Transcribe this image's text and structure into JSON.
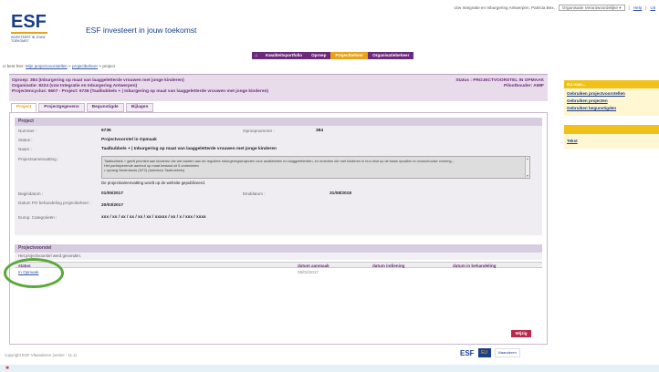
{
  "header": {
    "logo_big": "ESF",
    "logo_sub": "INVESTEERT IN JOUW TOEKOMST",
    "tagline": "ESF investeert in jouw toekomst",
    "user_text": "vzw Integratie en Inburgering Antwerpen, Patricia Bex,",
    "org_select": "Organisatie Verantwoordelijke",
    "help_link": "Help",
    "logout_link": "Uit"
  },
  "nav": {
    "home_icon": "home-icon",
    "items": [
      {
        "label": "Kwaliteitsportfolio"
      },
      {
        "label": "Oproep"
      },
      {
        "label": "Projectbeheer"
      },
      {
        "label": "Organisatiebeheer"
      }
    ]
  },
  "breadcrumb": {
    "prefix": "U bent hier:",
    "link1": "Mijn projectvoorstellen",
    "sep1": ">",
    "link2": "projectbeheer",
    "sep2": ">",
    "current": "project"
  },
  "project_header": {
    "line1": "Oproep: 384 (Inburgering op maat van laaggeletterde vrouwen met jonge kinderen)",
    "line2": "Organisatie: 8224 (vzw Integratie en Inburgering Antwerpen)",
    "line3": "Projectencyclus: 5607 - Project: 6736 (Taalbubbels + | Inburgering op maat van laaggeletterde vrouwen met jonge kinderen)",
    "status": "Status : PROJECTVOORSTEL IN OPMAAK",
    "promoter": "Pilootbouder: AMIF"
  },
  "tabs": [
    {
      "label": "Project"
    },
    {
      "label": "Projectgegevens"
    },
    {
      "label": "Begunstigde"
    },
    {
      "label": "Bijlagen"
    }
  ],
  "project_section": {
    "title": "Project",
    "nummer_label": "Nummer :",
    "nummer_value": "6736",
    "oproep_label": "Oproepnummer :",
    "oproep_value": "384",
    "status_label": "Status :",
    "status_value": "Projectvoorstel in Opmaak",
    "naam_label": "Naam :",
    "naam_value": "Taalbubbels + | Inburgering op maat van laaggeletterde vrouwen met jonge kinderen",
    "samenvatting_label": "Projectsamenvatting :",
    "samenvatting_text": "Taalbubbels + geeft prioriteit aan kinderen die wel starten aan de reguliere inburgeringstrajecten voor analfabeten en laaggeletterden, en moeders die met kinderen in hun kind op de basis opvallen in voorschoolse vorming...",
    "samenvatting_text2": "Het participerende aanbod op maat bestaat uit 5 onderdelen",
    "samenvatting_text3": "• opvang Nederlands (NT2) (talenhuis Taalbubbels)",
    "samenvatting_note": "De projectsamenvatting wordt op de website gepubliceerd.",
    "begindatum_label": "Begindatum :",
    "begindatum_value": "01/05/2017",
    "einddatum_label": "Einddatum :",
    "einddatum_value": "31/08/2018",
    "datum_label": "Datum PO behandeling projectbeheer :",
    "datum_value": "20/03/2017",
    "europ_label": "Europ. Categorieën :",
    "europ_value": "xxx / xx / xx / xx / xx / xx / xxxxx / xx / x / xxx / xxxx"
  },
  "projectvoorstel": {
    "title": "Projectvoorstel",
    "note": "Het projectvoorstel werd gevonden.",
    "col_status": "status",
    "col_aanmaak": "datum aanmaak",
    "col_indiening": "datum indiening",
    "col_behandeling": "datum in behandeling",
    "row_status": "In Opmaak",
    "row_aanmaak": "08/02/2017",
    "row_indiening": "",
    "row_behandeling": ""
  },
  "action": {
    "wijzig": "Wijzig"
  },
  "sidebar": {
    "title": "Ga naar...",
    "links": [
      {
        "label": "Gebruiken projectvoorstellen"
      },
      {
        "label": "Gebruiken projecten"
      },
      {
        "label": "Gebruiken begunstigden"
      }
    ],
    "title2": "",
    "link2": "Tekst"
  },
  "footer": {
    "copyright": "copyright ESF Vlaanderen",
    "version": "(versie : 11.1)",
    "logo_esf": "ESF",
    "logo_eu": "EU",
    "logo_vl": "Vlaanderen"
  },
  "colors": {
    "purple": "#6b2b7a",
    "orange": "#e8a31b",
    "yellow": "#f0c11a",
    "navy": "#1a3d8c",
    "highlight": "#5aa83c",
    "wijzig": "#b8294b"
  }
}
